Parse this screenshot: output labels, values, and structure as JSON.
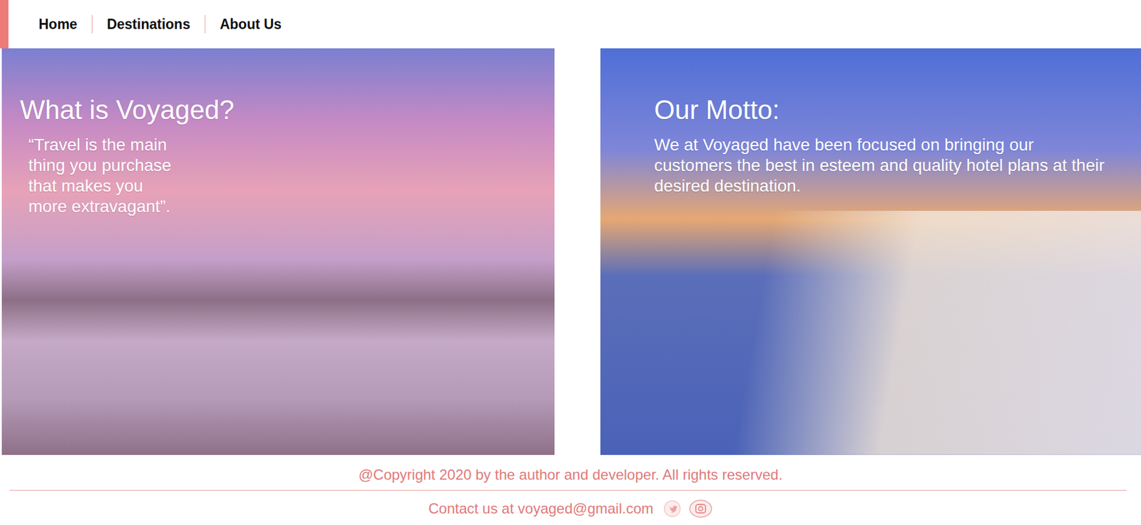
{
  "nav": {
    "items": [
      {
        "label": "Home"
      },
      {
        "label": "Destinations"
      },
      {
        "label": "About Us"
      }
    ]
  },
  "panels": [
    {
      "title": "What is Voyaged?",
      "text": "“Travel is the main thing you purchase that makes you more extravagant”.",
      "kind": "quote"
    },
    {
      "title": "Our Motto:",
      "text": "We at Voyaged have been focused on bringing our customers the best in esteem and quality hotel plans at their desired destination.",
      "kind": "motto"
    }
  ],
  "footer": {
    "copyright": "@Copyright 2020 by the author and developer. All rights reserved.",
    "contact": "Contact us at voyaged@gmail.com"
  }
}
